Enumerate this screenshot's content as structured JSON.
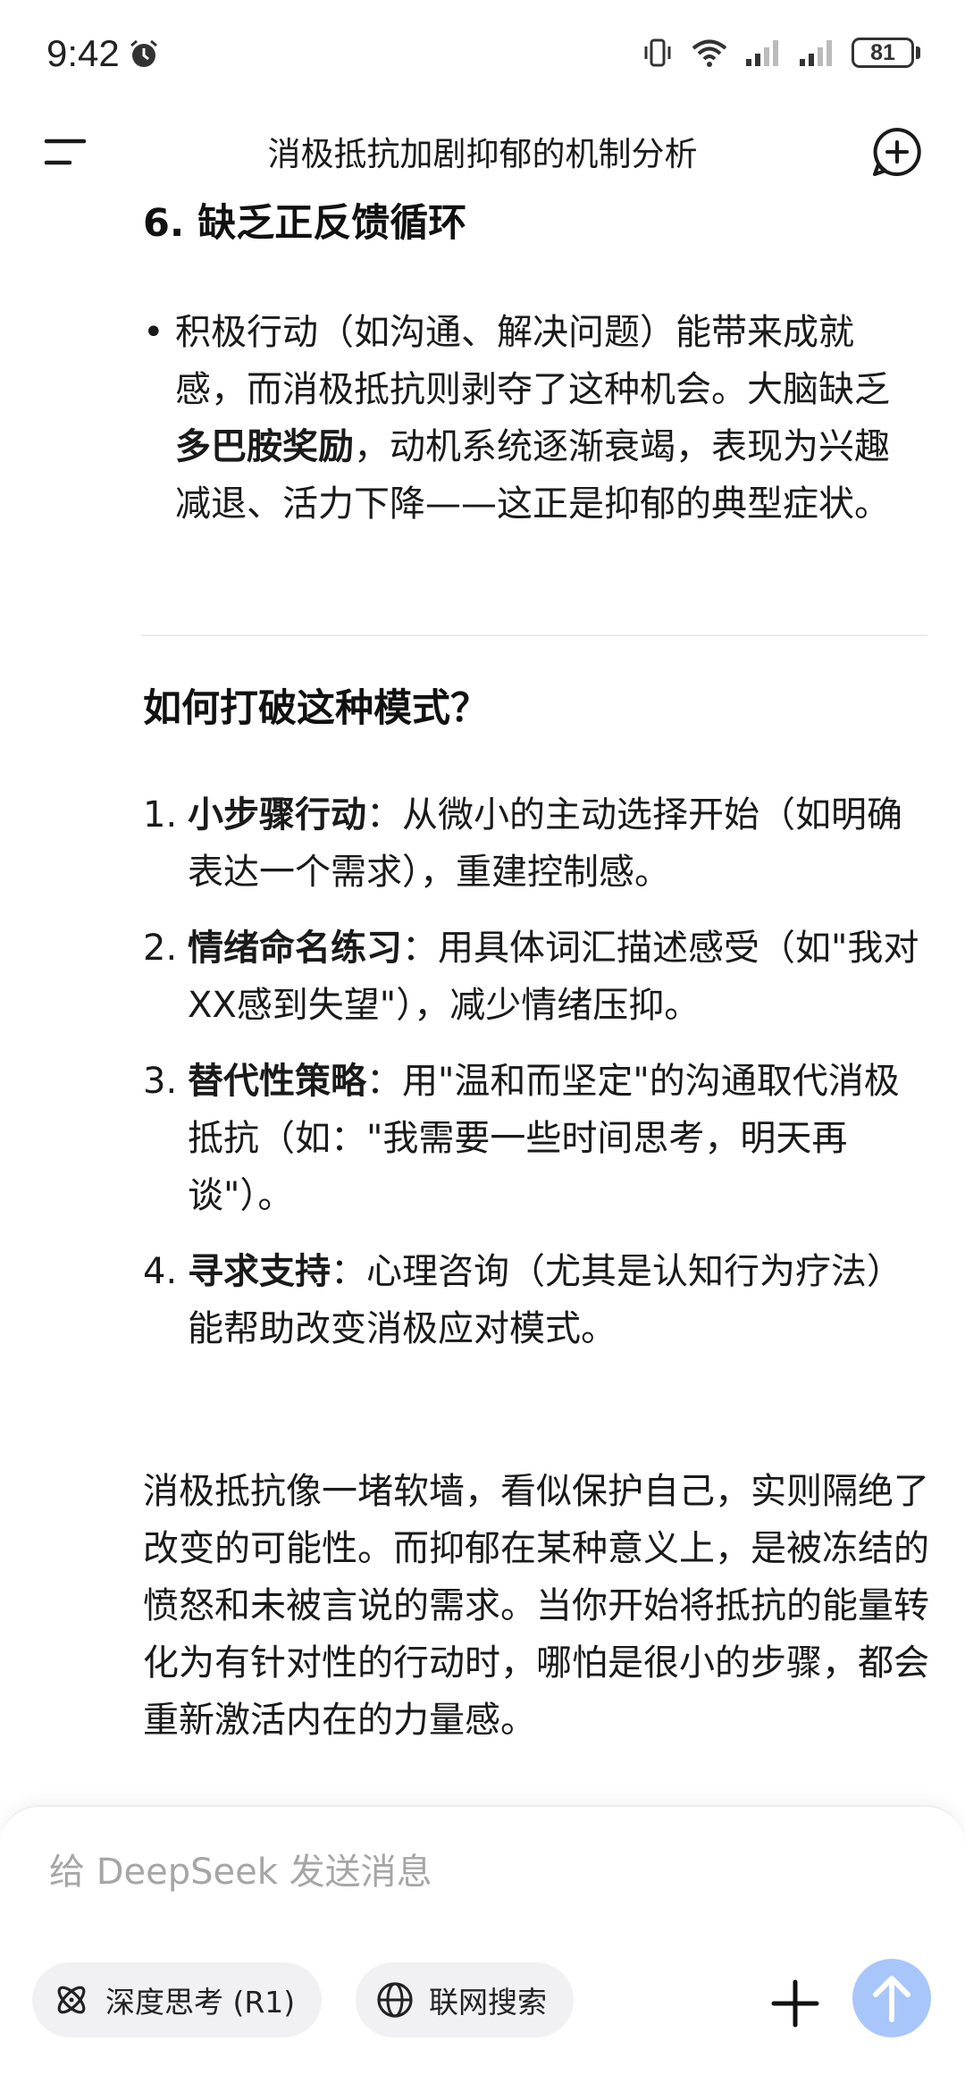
{
  "status_bar": {
    "time": "9:42",
    "battery": "81",
    "icons": [
      "alarm-icon",
      "vibrate-icon",
      "wifi-icon",
      "signal-icon",
      "signal-icon",
      "battery-icon"
    ]
  },
  "header": {
    "title": "消极抵抗加剧抑郁的机制分析",
    "menu_icon": "menu-icon",
    "new_chat_icon": "new-chat-icon"
  },
  "content": {
    "section6_title": "6. 缺乏正反馈循环",
    "bullet": {
      "before": "积极行动（如沟通、解决问题）能带来成就感，而消极抵抗则剥夺了这种机会。大脑缺乏",
      "bold": "多巴胺奖励",
      "after": "，动机系统逐渐衰竭，表现为兴趣减退、活力下降——这正是抑郁的典型症状。"
    },
    "break_title": "如何打破这种模式？",
    "steps": [
      {
        "num": "1.",
        "bold": "小步骤行动",
        "text": "：从微小的主动选择开始（如明确表达一个需求），重建控制感。"
      },
      {
        "num": "2.",
        "bold": "情绪命名练习",
        "text": "：用具体词汇描述感受（如\"我对XX感到失望\"），减少情绪压抑。"
      },
      {
        "num": "3.",
        "bold": "替代性策略",
        "text": "：用\"温和而坚定\"的沟通取代消极抵抗（如：\"我需要一些时间思考，明天再谈\"）。"
      },
      {
        "num": "4.",
        "bold": "寻求支持",
        "text": "：心理咨询（尤其是认知行为疗法）能帮助改变消极应对模式。"
      }
    ],
    "conclusion": "消极抵抗像一堵软墙，看似保护自己，实则隔绝了改变的可能性。而抑郁在某种意义上，是被冻结的愤怒和未被言说的需求。当你开始将抵抗的能量转化为有针对性的行动时，哪怕是很小的步骤，都会重新激活内在的力量感。"
  },
  "input": {
    "placeholder": "给 DeepSeek 发送消息",
    "deep_think_label": "深度思考 (R1)",
    "web_search_label": "联网搜索"
  },
  "colors": {
    "send_button": "#a9c6fb",
    "chip_bg": "#f1f1f3",
    "placeholder": "#a6a6a6"
  }
}
